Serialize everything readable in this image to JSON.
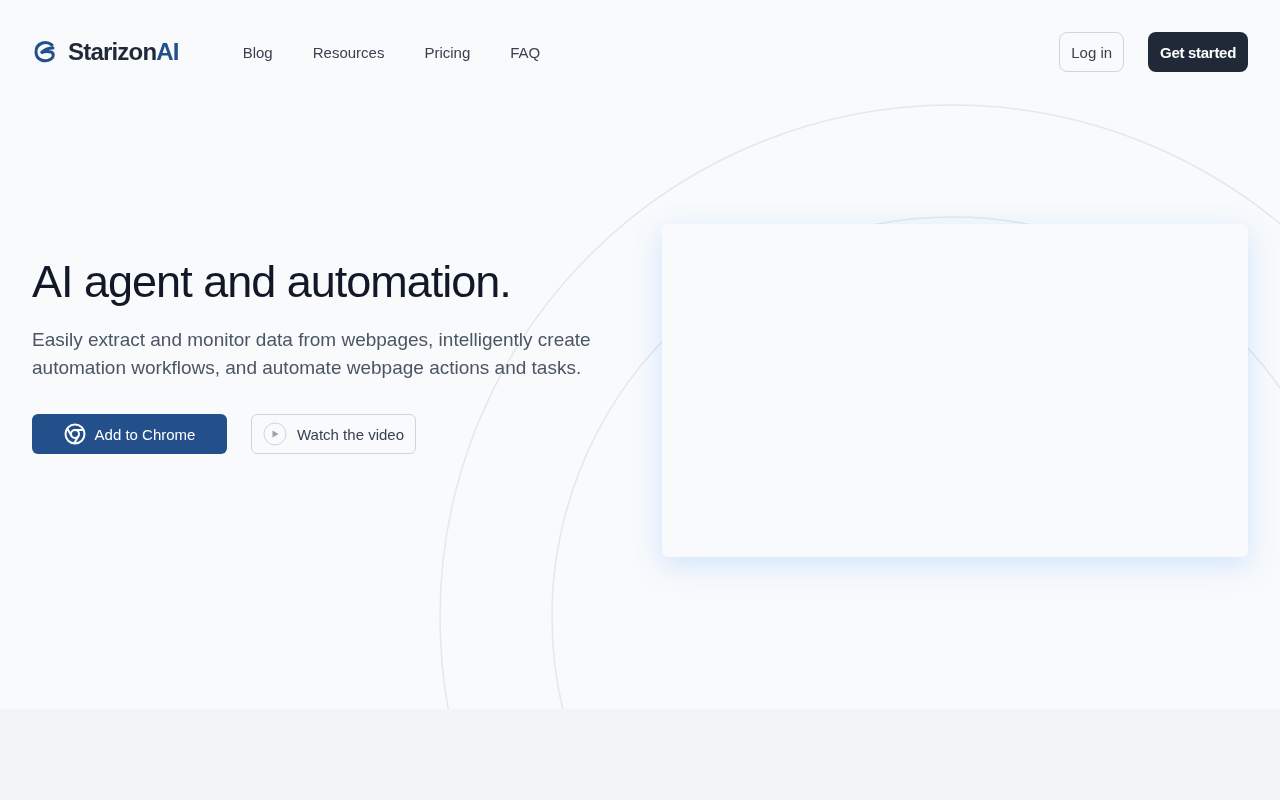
{
  "brand": {
    "name": "Starizon",
    "accent": "AI"
  },
  "nav": [
    "Blog",
    "Resources",
    "Pricing",
    "FAQ"
  ],
  "actions": {
    "login": "Log in",
    "signup": "Get started"
  },
  "hero": {
    "title": "AI agent and automation.",
    "subtitle": "Easily extract and monitor data from webpages, intelligently create automation workflows, and automate webpage actions and tasks.",
    "primary": "Add to Chrome",
    "secondary": "Watch the video"
  }
}
